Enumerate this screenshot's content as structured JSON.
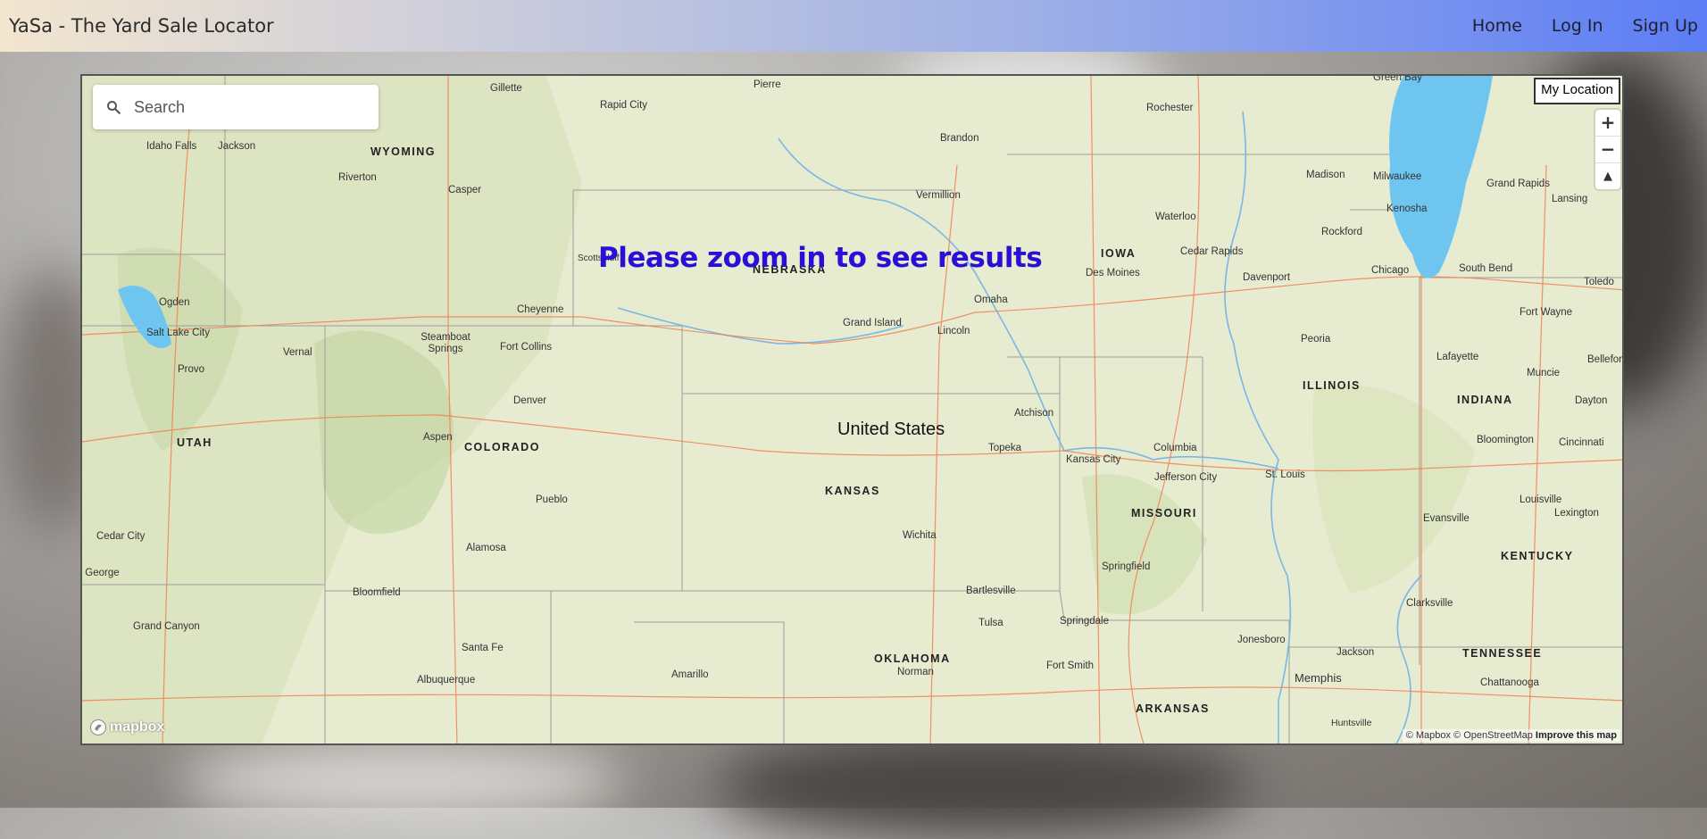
{
  "navbar": {
    "brand": "YaSa - The Yard Sale Locator",
    "links": [
      "Home",
      "Log In",
      "Sign Up"
    ]
  },
  "map": {
    "search_placeholder": "Search",
    "my_location_label": "My Location",
    "zoom_in": "+",
    "zoom_out": "−",
    "compass": "▲",
    "message": "Please zoom in to see results",
    "country_label": "United States",
    "logo_text": "mapbox",
    "attribution": "© Mapbox © OpenStreetMap",
    "improve_link": "Improve this map",
    "states": [
      "WYOMING",
      "NEBRASKA",
      "IOWA",
      "UTAH",
      "COLORADO",
      "KANSAS",
      "MISSOURI",
      "ILLINOIS",
      "INDIANA",
      "OKLAHOMA",
      "KENTUCKY",
      "TENNESSEE",
      "ARKANSAS"
    ],
    "cities": [
      "Gillette",
      "Pierre",
      "Rapid City",
      "Brandon",
      "Rochester",
      "Green Bay",
      "Idaho Falls",
      "Jackson",
      "Riverton",
      "Casper",
      "Vermillion",
      "Madison",
      "Milwaukee",
      "Grand Rapids",
      "Lansing",
      "Kenosha",
      "Waterloo",
      "Rockford",
      "Scottsbluff",
      "Cedar Rapids",
      "Des Moines",
      "Davenport",
      "Chicago",
      "South Bend",
      "Toledo",
      "Ogden",
      "Salt Lake City",
      "Cheyenne",
      "Omaha",
      "Grand Island",
      "Lincoln",
      "Fort Wayne",
      "Vernal",
      "Steamboat Springs",
      "Fort Collins",
      "Peoria",
      "Lafayette",
      "Muncie",
      "Bellefontaine",
      "Provo",
      "Denver",
      "Atchison",
      "Dayton",
      "Aspen",
      "Topeka",
      "Kansas City",
      "Columbia",
      "Bloomington",
      "Cincinnati",
      "Jefferson City",
      "St. Louis",
      "Louisville",
      "Pueblo",
      "Lexington",
      "Cedar City",
      "Wichita",
      "Evansville",
      "Alamosa",
      "St. George",
      "Springfield",
      "Bloomfield",
      "Bartlesville",
      "Clarksville",
      "Grand Canyon",
      "Tulsa",
      "Springdale",
      "Santa Fe",
      "Jonesboro",
      "Jackson",
      "Amarillo",
      "Norman",
      "Fort Smith",
      "Memphis",
      "Albuquerque",
      "Chattanooga",
      "Huntsville"
    ]
  }
}
